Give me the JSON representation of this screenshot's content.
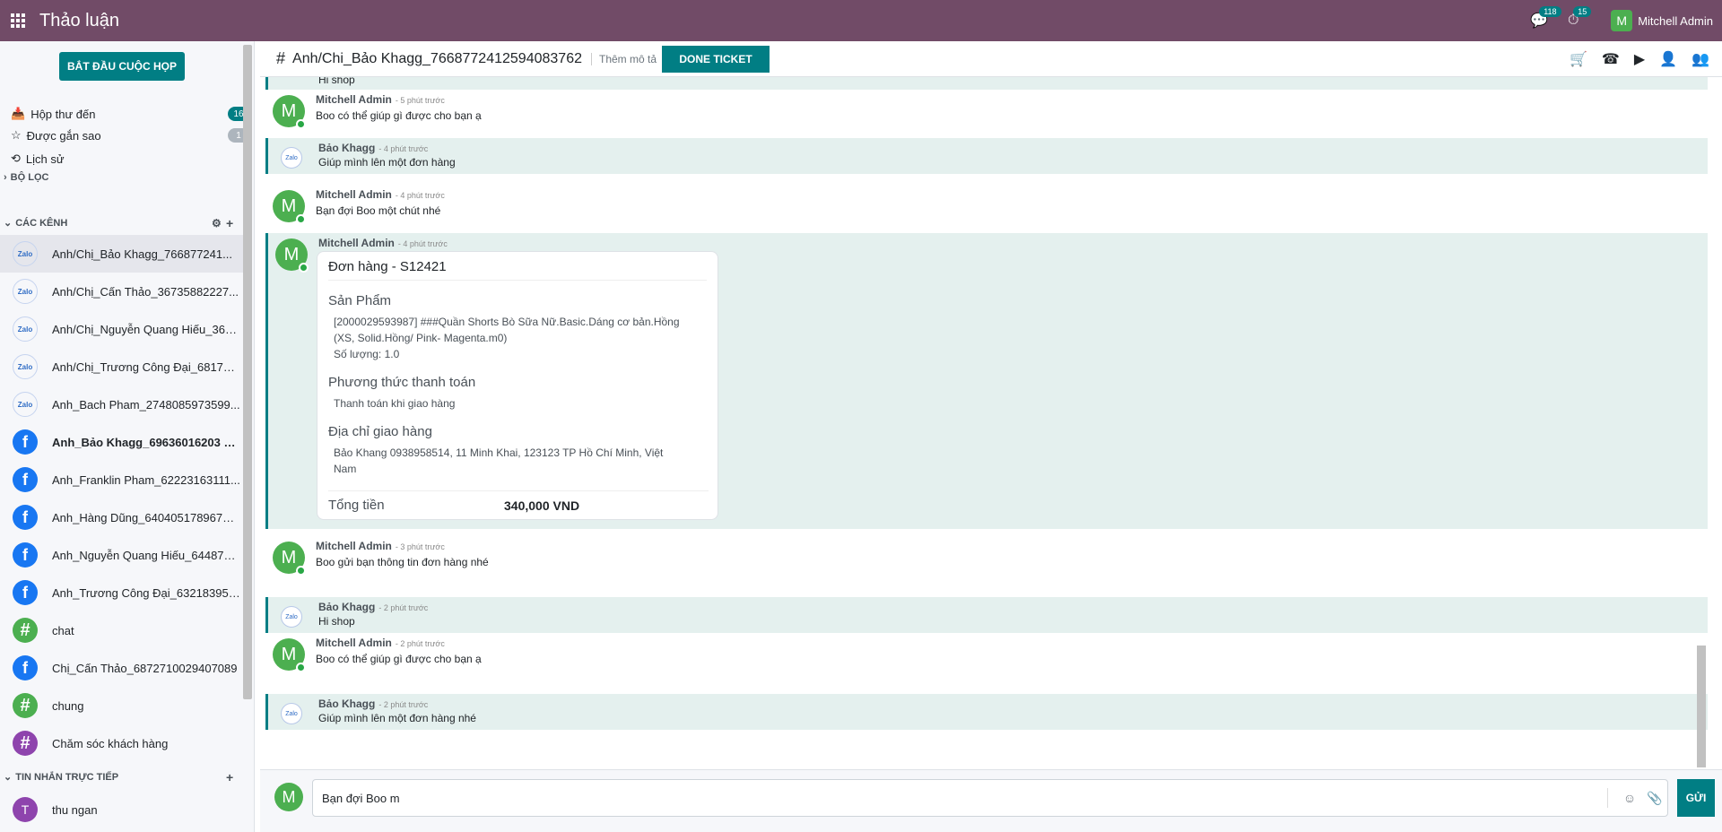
{
  "app": {
    "title": "Thảo luận"
  },
  "systray": {
    "messages_count": "118",
    "activity_count": "15",
    "user_name": "Mitchell Admin",
    "user_initial": "M"
  },
  "sidebar": {
    "start_meeting": "BẮT ĐẦU CUỘC HỌP",
    "mailboxes": [
      {
        "label": "Hộp thư đến",
        "count": "16"
      },
      {
        "label": "Được gắn sao",
        "count": "1"
      },
      {
        "label": "Lịch sử",
        "count": ""
      }
    ],
    "filter_label": "BỘ LỌC",
    "channels_label": "CÁC KÊNH",
    "channels": [
      {
        "name": "Anh/Chị_Bảo Khagg_766877241...",
        "icon": "zalo"
      },
      {
        "name": "Anh/Chị_Cấn Thảo_36735882227...",
        "icon": "zalo"
      },
      {
        "name": "Anh/Chị_Nguyễn Quang Hiếu_365...",
        "icon": "zalo"
      },
      {
        "name": "Anh/Chị_Trương Công Đại_681782...",
        "icon": "zalo"
      },
      {
        "name": "Anh_Bach Pham_2748085973599...",
        "icon": "zalo"
      },
      {
        "name": "Anh_Bảo Khagg_69636016203 71...",
        "icon": "facebook"
      },
      {
        "name": "Anh_Franklin Pham_62223163111...",
        "icon": "facebook"
      },
      {
        "name": "Anh_Hàng Dũng_64040517896742...",
        "icon": "facebook"
      },
      {
        "name": "Anh_Nguyễn Quang Hiếu_6448767...",
        "icon": "facebook"
      },
      {
        "name": "Anh_Trương Công Đại_632183955...",
        "icon": "facebook"
      },
      {
        "name": "chat",
        "icon": "hash"
      },
      {
        "name": "Chị_Cấn Thảo_6872710029407089",
        "icon": "facebook"
      },
      {
        "name": "chung",
        "icon": "hash"
      },
      {
        "name": "Chăm sóc khách hàng",
        "icon": "hash"
      }
    ],
    "direct_label": "TIN NHẮN TRỰC TIẾP",
    "direct": [
      {
        "name": "thu ngan",
        "initial": "T"
      }
    ]
  },
  "header": {
    "channel_name": "Anh/Chi_Bảo Khagg_7668772412594083762",
    "add_description": "Thêm mô tả",
    "done_ticket": "DONE TICKET"
  },
  "messages": [
    {
      "author": "",
      "time": "",
      "body": "Hi shop"
    },
    {
      "author": "Mitchell Admin",
      "time": "- 5 phút trước",
      "body": "Boo có thể giúp gì được cho bạn ạ"
    },
    {
      "author": "Bảo Khagg",
      "time": "- 4 phút trước",
      "body": "Giúp mình lên một đơn hàng"
    },
    {
      "author": "Mitchell Admin",
      "time": "- 4 phút trước",
      "body": "Bạn đợi Boo một chút nhé"
    },
    {
      "author": "Mitchell Admin",
      "time": "- 4 phút trước",
      "body": ""
    },
    {
      "author": "Mitchell Admin",
      "time": "- 3 phút trước",
      "body": "Boo gửi bạn thông tin đơn hàng nhé"
    },
    {
      "author": "Bảo Khagg",
      "time": "- 2 phút trước",
      "body": "Hi shop"
    },
    {
      "author": "Mitchell Admin",
      "time": "- 2 phút trước",
      "body": "Boo có thể giúp gì được cho bạn ạ"
    },
    {
      "author": "Bảo Khagg",
      "time": "- 2 phút trước",
      "body": "Giúp mình lên một đơn hàng nhé"
    }
  ],
  "order": {
    "title": "Đơn hàng - S12421",
    "product_label": "Sản Phẩm",
    "product_line1": "[2000029593987] ###Quần Shorts Bò Sữa Nữ.Basic.Dáng cơ bản.Hồng",
    "product_line2": "(XS, Solid.Hồng/ Pink- Magenta.m0)",
    "quantity": "Số lượng: 1.0",
    "payment_label": "Phương thức thanh toán",
    "payment_value": "Thanh toán khi giao hàng",
    "address_label": "Địa chỉ giao hàng",
    "address_line1": "Bảo Khang 0938958514, 11 Minh Khai, 123123 TP Hồ Chí Minh, Việt",
    "address_line2": "Nam",
    "total_label": "Tổng tiền",
    "total_value": "340,000 VND"
  },
  "composer": {
    "text": "Bạn đợi Boo m",
    "send": "GỬI"
  },
  "colors": {
    "brand": "#714b67",
    "accent": "#017e84"
  }
}
